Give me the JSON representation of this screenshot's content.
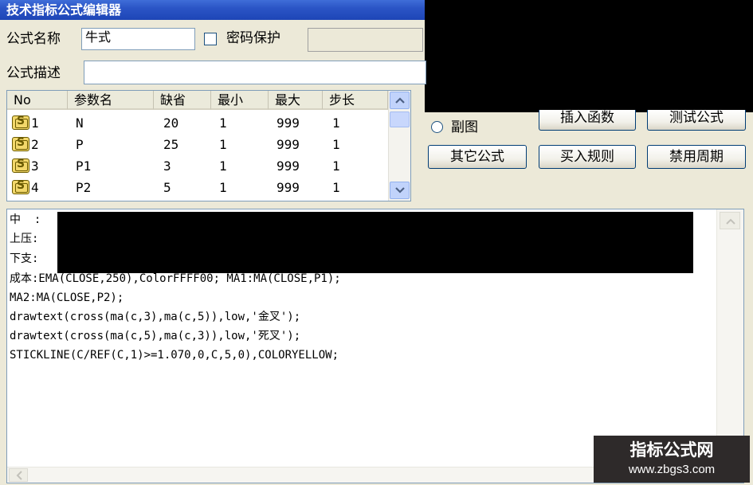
{
  "window": {
    "title": "技术指标公式编辑器"
  },
  "form": {
    "name_label": "公式名称",
    "name_value": "牛式",
    "password_label": "密码保护",
    "password_value": "",
    "desc_label": "公式描述",
    "desc_value": ""
  },
  "params": {
    "headers": [
      "No",
      "参数名",
      "缺省",
      "最小",
      "最大",
      "步长"
    ],
    "rows": [
      {
        "no": "1",
        "name": "N",
        "default": "20",
        "min": "1",
        "max": "999",
        "step": "1"
      },
      {
        "no": "2",
        "name": "P",
        "default": "25",
        "min": "1",
        "max": "999",
        "step": "1"
      },
      {
        "no": "3",
        "name": "P1",
        "default": "3",
        "min": "1",
        "max": "999",
        "step": "1"
      },
      {
        "no": "4",
        "name": "P2",
        "default": "5",
        "min": "1",
        "max": "999",
        "step": "1"
      }
    ]
  },
  "options": {
    "subchart_label": "副图",
    "buttons": {
      "insert_function": "插入函数",
      "test_formula": "测试公式",
      "other_formulas": "其它公式",
      "buy_rules": "买入规则",
      "disable_periods": "禁用周期"
    }
  },
  "code": {
    "lines": [
      "中  :",
      "上压:",
      "下支:",
      "成本:EMA(CLOSE,250),ColorFFFF00; MA1:MA(CLOSE,P1);",
      "MA2:MA(CLOSE,P2);",
      "drawtext(cross(ma(c,3),ma(c,5)),low,'金叉');",
      "drawtext(cross(ma(c,5),ma(c,3)),low,'死叉');",
      "STICKLINE(C/REF(C,1)>=1.070,0,C,5,0),COLORYELLOW;"
    ]
  },
  "watermark": {
    "title": "指标公式网",
    "url": "www.zbgs3.com"
  },
  "colors": {
    "titlebar": "#2b55c6",
    "dialog_bg": "#ece9d8",
    "redaction": "#000000"
  }
}
